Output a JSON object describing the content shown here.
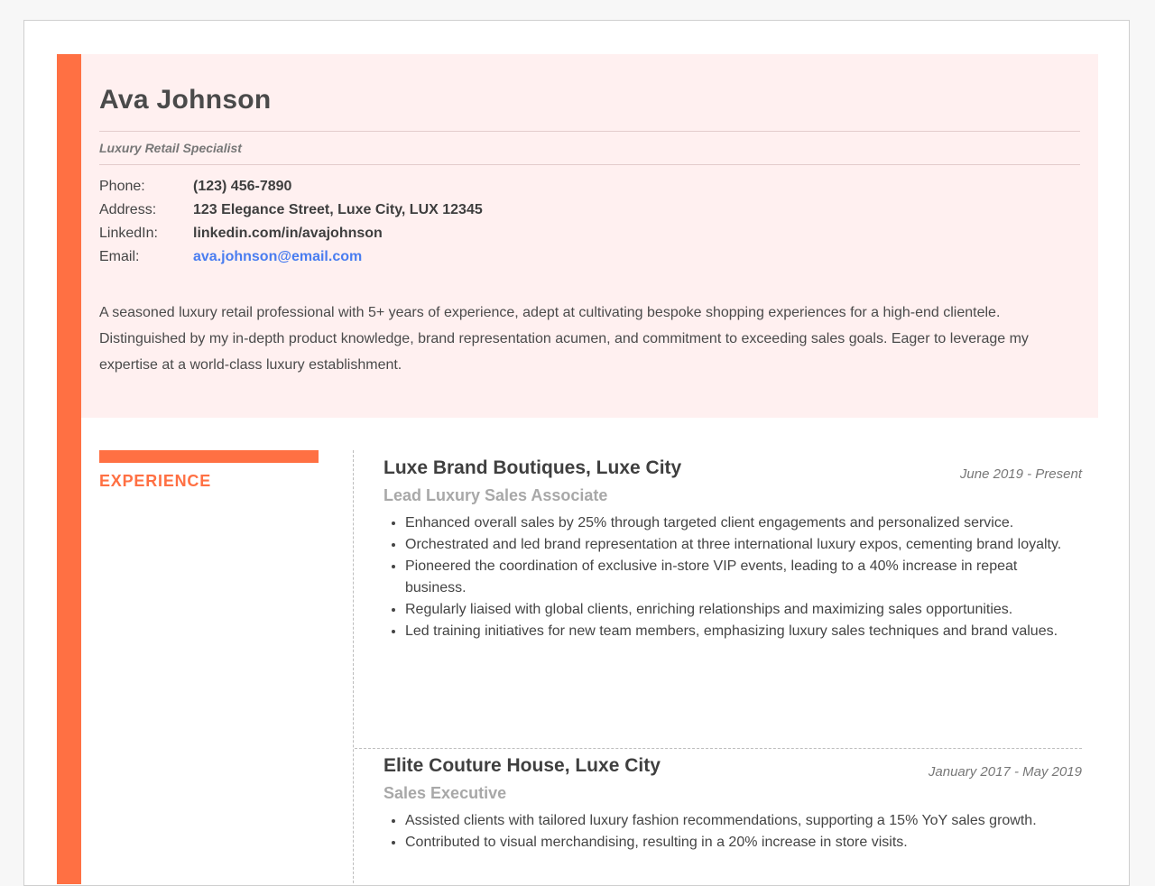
{
  "header": {
    "name": "Ava Johnson",
    "title": "Luxury Retail Specialist",
    "contact": [
      {
        "label": "Phone:",
        "value": "(123) 456-7890"
      },
      {
        "label": "Address:",
        "value": "123 Elegance Street, Luxe City, LUX 12345"
      },
      {
        "label": "LinkedIn:",
        "value": "linkedin.com/in/avajohnson"
      },
      {
        "label": "Email:",
        "value": "ava.johnson@email.com"
      }
    ],
    "summary": "A seasoned luxury retail professional with 5+ years of experience, adept at cultivating bespoke shopping experiences for a high-end clientele. Distinguished by my in-depth product knowledge, brand representation acumen, and commitment to exceeding sales goals. Eager to leverage my expertise at a world-class luxury establishment."
  },
  "experience": {
    "heading": "EXPERIENCE",
    "jobs": [
      {
        "company": "Luxe Brand Boutiques, Luxe City",
        "dates": "June 2019 - Present",
        "role": "Lead Luxury Sales Associate",
        "bullets": [
          "Enhanced overall sales by 25% through targeted client engagements and personalized service.",
          "Orchestrated and led brand representation at three international luxury expos, cementing brand loyalty.",
          "Pioneered the coordination of exclusive in-store VIP events, leading to a 40% increase in repeat business.",
          "Regularly liaised with global clients, enriching relationships and maximizing sales opportunities.",
          "Led training initiatives for new team members, emphasizing luxury sales techniques and brand values."
        ]
      },
      {
        "company": "Elite Couture House, Luxe City",
        "dates": "January 2017 - May 2019",
        "role": "Sales Executive",
        "bullets": [
          "Assisted clients with tailored luxury fashion recommendations, supporting a 15% YoY sales growth.",
          "Contributed to visual merchandising, resulting in a 20% increase in store visits."
        ]
      }
    ]
  },
  "colors": {
    "accent": "#ff7043",
    "header_bg": "#fff0f0",
    "link": "#4a7df0"
  }
}
